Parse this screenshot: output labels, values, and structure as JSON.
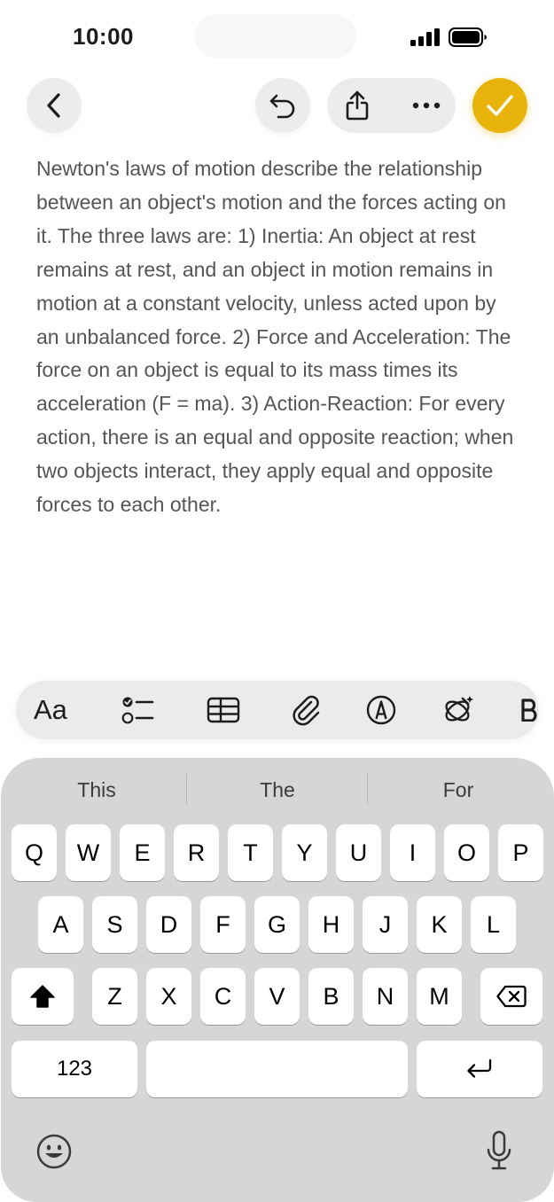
{
  "status_bar": {
    "time": "10:00"
  },
  "note": {
    "text": "Newton's laws of motion describe the relationship between an object's motion and the forces acting on it. The three laws are: 1) Inertia: An object at rest remains at rest, and an object in motion remains in motion at a constant velocity, unless acted upon by an unbalanced force. 2) Force and Acceleration: The force on an object is equal to its mass times its acceleration (F = ma). 3) Action-Reaction: For every action, there is an equal and opposite reaction; when two objects interact, they apply equal and opposite forces to each other."
  },
  "format_bar": {
    "text_style_label": "Aa"
  },
  "keyboard": {
    "suggestions": [
      "This",
      "The",
      "For"
    ],
    "row1": [
      "Q",
      "W",
      "E",
      "R",
      "T",
      "Y",
      "U",
      "I",
      "O",
      "P"
    ],
    "row2": [
      "A",
      "S",
      "D",
      "F",
      "G",
      "H",
      "J",
      "K",
      "L"
    ],
    "row3": [
      "Z",
      "X",
      "C",
      "V",
      "B",
      "N",
      "M"
    ],
    "numbers_label": "123"
  },
  "colors": {
    "accent": "#e8b40c",
    "keyboard_bg": "#d6d6d7",
    "toolbar_bg": "#ececec"
  }
}
